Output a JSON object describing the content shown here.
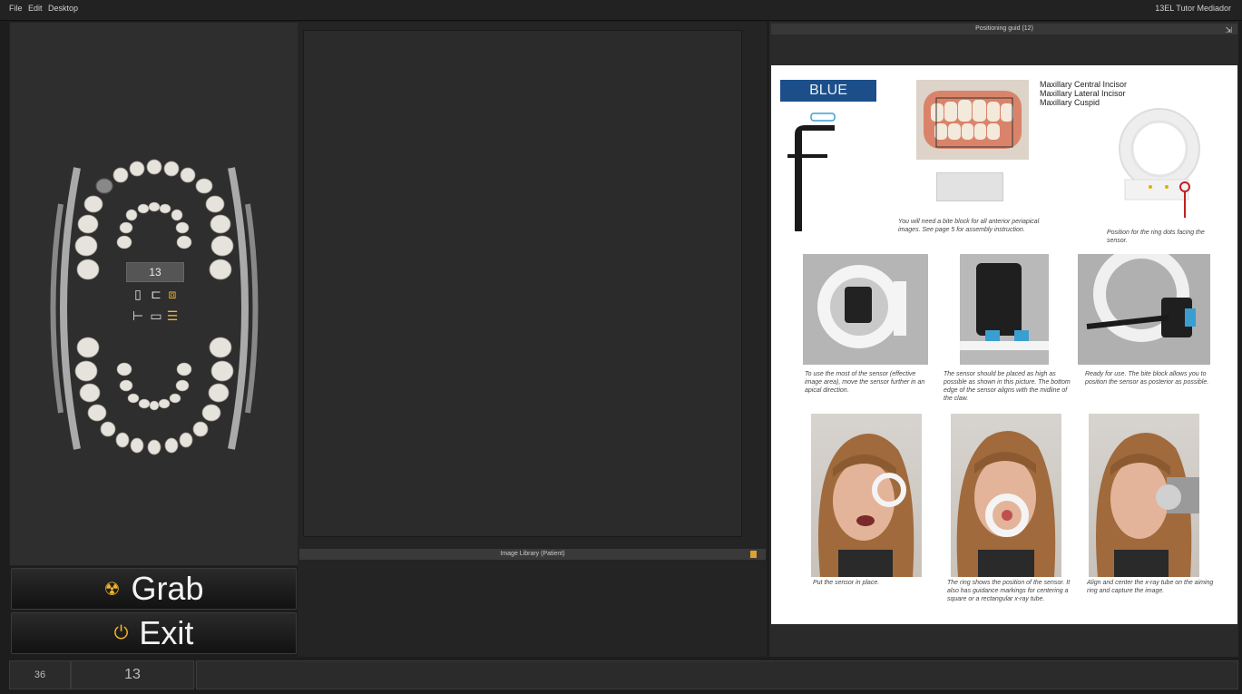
{
  "menubar": {
    "items": [
      "File",
      "Edit",
      "Desktop"
    ],
    "app_title": "13EL Tutor Mediador"
  },
  "tooth_panel": {
    "selected_tooth": "13"
  },
  "actions": {
    "grab_label": "Grab",
    "exit_label": "Exit",
    "accent_color": "#f0b429"
  },
  "image_library": {
    "title": "Image Library (Patient)"
  },
  "positioning_guide": {
    "title": "Positioning guid (12)",
    "color_badge": "BLUE",
    "teeth_list": [
      "Maxillary Central Incisor",
      "Maxillary Lateral Incisor",
      "Maxillary Cuspid"
    ],
    "bite_block_note": "You will need a bite block for all anterior periapical images. See page 5 for assembly instruction.",
    "ring_note": "Position for the ring dots facing the sensor.",
    "step_captions": [
      "To use the most of the sensor (effective image area), move the sensor further in an apical direction.",
      "The sensor should be placed as high as possible as shown in this picture. The bottom edge of the sensor aligns with the midline of the claw.",
      "Ready for use. The bite block allows you to position the sensor as posterior as possible.",
      "Put the sensor in place.",
      "The ring shows the position of the sensor. It also has guidance markings for centering a square or a rectangular x-ray tube.",
      "Align and center the x-ray tube on the aiming ring and capture the image."
    ]
  },
  "status_bar": {
    "left_value": "36",
    "tooth_value": "13"
  },
  "icons": [
    "radiation-icon",
    "power-icon",
    "lock-icon",
    "pin-icon",
    "sensor-icon",
    "swap-icon",
    "rotate-icon",
    "ruler-icon"
  ]
}
